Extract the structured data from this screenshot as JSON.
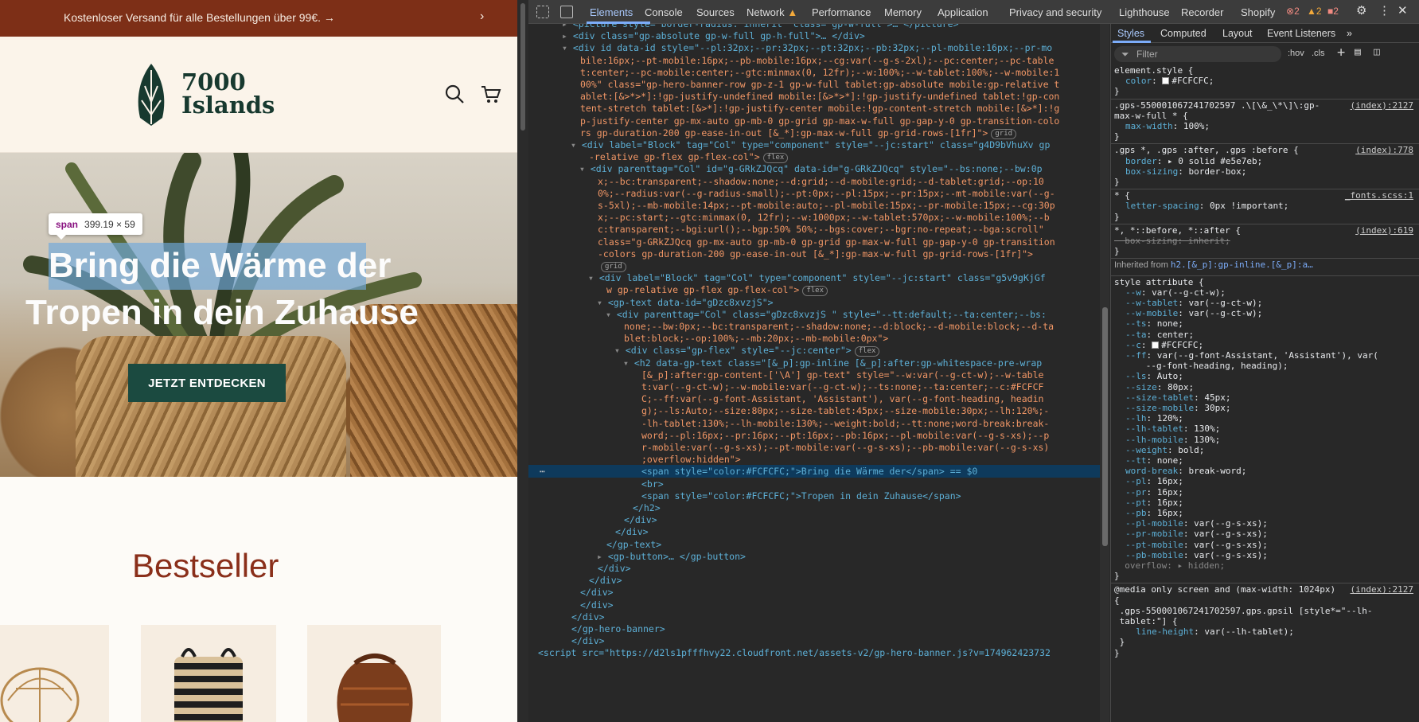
{
  "site": {
    "announcement": "Kostenloser Versand für alle Bestellungen über 99€.",
    "logo_line1": "7000",
    "logo_line2": "Islands",
    "tooltip_tag": "span",
    "tooltip_size": "399.19 × 59",
    "hero_line1": "Bring die Wärme der",
    "hero_line2": "Tropen in dein Zuhause",
    "cta": "JETZT ENTDECKEN",
    "bestseller": "Bestseller"
  },
  "devtools": {
    "tabs": [
      "Elements",
      "Console",
      "Sources",
      "Network",
      "Performance",
      "Memory",
      "Application",
      "Privacy and security",
      "Lighthouse",
      "Recorder",
      "Shopify"
    ],
    "badges": {
      "errors": "2",
      "warnings": "2",
      "issues": "2"
    },
    "style_tabs": [
      "Styles",
      "Computed",
      "Layout",
      "Event Listeners"
    ],
    "filter_placeholder": "Filter",
    "hov": ":hov",
    "cls": ".cls"
  },
  "dom_lines": [
    {
      "t": "<picture style=\"border-radius: inherit\" class=\"gp-w-full\">… </picture>",
      "i": 0,
      "pre": "▸ "
    },
    {
      "t": "<div class=\"gp-absolute gp-w-full gp-h-full\">… </div>",
      "i": 0,
      "pre": "▸ "
    },
    {
      "t": "<div id data-id style=\"--pl:32px;--pr:32px;--pt:32px;--pb:32px;--pl-mobile:16px;--pr-mo",
      "i": 0,
      "pre": "▾ "
    },
    {
      "t": "bile:16px;--pt-mobile:16px;--pb-mobile:16px;--cg:var(--g-s-2xl);--pc:center;--pc-table",
      "i": 1,
      "pre": ""
    },
    {
      "t": "t:center;--pc-mobile:center;--gtc:minmax(0, 12fr);--w:100%;--w-tablet:100%;--w-mobile:1",
      "i": 1,
      "pre": ""
    },
    {
      "t": "00%\" class=\"gp-hero-banner-row gp-z-1 gp-w-full tablet:gp-absolute mobile:gp-relative t",
      "i": 1,
      "pre": ""
    },
    {
      "t": "ablet:[&>*>*]:!gp-justify-undefined mobile:[&>*>*]:!gp-justify-undefined tablet:!gp-con",
      "i": 1,
      "pre": ""
    },
    {
      "t": "tent-stretch tablet:[&>*]:!gp-justify-center mobile:!gp-content-stretch mobile:[&>*]:!g",
      "i": 1,
      "pre": ""
    },
    {
      "t": "p-justify-center gp-mx-auto gp-mb-0 gp-grid gp-max-w-full gp-gap-y-0 gp-transition-colo",
      "i": 1,
      "pre": ""
    },
    {
      "t": "rs gp-duration-200 gp-ease-in-out [&_*]:gp-max-w-full gp-grid-rows-[1fr]\">",
      "i": 1,
      "pre": "",
      "pill": "grid"
    },
    {
      "t": "<div label=\"Block\" tag=\"Col\" type=\"component\" style=\"--jc:start\" class=\"g4D9bVhuXv gp",
      "i": 1,
      "pre": "▾ "
    },
    {
      "t": "-relative gp-flex gp-flex-col\">",
      "i": 2,
      "pre": "",
      "pill": "flex"
    },
    {
      "t": "<div parenttag=\"Col\" id=\"g-GRkZJQcq\" data-id=\"g-GRkZJQcq\" style=\"--bs:none;--bw:0p",
      "i": 2,
      "pre": "▾ "
    },
    {
      "t": "x;--bc:transparent;--shadow:none;--d:grid;--d-mobile:grid;--d-tablet:grid;--op:10",
      "i": 3,
      "pre": ""
    },
    {
      "t": "0%;--radius:var(--g-radius-small);--pt:0px;--pl:15px;--pr:15px;--mt-mobile:var(--g-",
      "i": 3,
      "pre": ""
    },
    {
      "t": "s-5xl);--mb-mobile:14px;--pt-mobile:auto;--pl-mobile:15px;--pr-mobile:15px;--cg:30p",
      "i": 3,
      "pre": ""
    },
    {
      "t": "x;--pc:start;--gtc:minmax(0, 12fr);--w:1000px;--w-tablet:570px;--w-mobile:100%;--b",
      "i": 3,
      "pre": ""
    },
    {
      "t": "c:transparent;--bgi:url();--bgp:50% 50%;--bgs:cover;--bgr:no-repeat;--bga:scroll\"",
      "i": 3,
      "pre": ""
    },
    {
      "t": "class=\"g-GRkZJQcq gp-mx-auto gp-mb-0 gp-grid gp-max-w-full gp-gap-y-0 gp-transition",
      "i": 3,
      "pre": ""
    },
    {
      "t": "-colors gp-duration-200 gp-ease-in-out [&_*]:gp-max-w-full gp-grid-rows-[1fr]\">",
      "i": 3,
      "pre": ""
    },
    {
      "t": "",
      "i": 3,
      "pre": "",
      "pill": "grid"
    },
    {
      "t": "<div label=\"Block\" tag=\"Col\" type=\"component\" style=\"--jc:start\" class=\"g5v9gKjGf",
      "i": 3,
      "pre": "▾ "
    },
    {
      "t": "w gp-relative gp-flex gp-flex-col\">",
      "i": 4,
      "pre": "",
      "pill": "flex"
    },
    {
      "t": "<gp-text data-id=\"gDzc8xvzjS\">",
      "i": 4,
      "pre": "▾ "
    },
    {
      "t": "<div parenttag=\"Col\" class=\"gDzc8xvzjS \" style=\"--tt:default;--ta:center;--bs:",
      "i": 5,
      "pre": "▾ "
    },
    {
      "t": "none;--bw:0px;--bc:transparent;--shadow:none;--d:block;--d-mobile:block;--d-ta",
      "i": 6,
      "pre": ""
    },
    {
      "t": "blet:block;--op:100%;--mb:20px;--mb-mobile:0px\">",
      "i": 6,
      "pre": ""
    },
    {
      "t": "<div class=\"gp-flex\" style=\"--jc:center\">",
      "i": 6,
      "pre": "▾ ",
      "pill": "flex"
    },
    {
      "t": "<h2 data-gp-text class=\"[&_p]:gp-inline [&_p]:after:gp-whitespace-pre-wrap",
      "i": 7,
      "pre": "▾ "
    },
    {
      "t": "[&_p]:after:gp-content-['\\A'] gp-text\" style=\"--w:var(--g-ct-w);--w-table",
      "i": 8,
      "pre": ""
    },
    {
      "t": "t:var(--g-ct-w);--w-mobile:var(--g-ct-w);--ts:none;--ta:center;--c:#FCFCF",
      "i": 8,
      "pre": ""
    },
    {
      "t": "C;--ff:var(--g-font-Assistant, 'Assistant'), var(--g-font-heading, headin",
      "i": 8,
      "pre": ""
    },
    {
      "t": "g);--ls:Auto;--size:80px;--size-tablet:45px;--size-mobile:30px;--lh:120%;-",
      "i": 8,
      "pre": ""
    },
    {
      "t": "-lh-tablet:130%;--lh-mobile:130%;--weight:bold;--tt:none;word-break:break-",
      "i": 8,
      "pre": ""
    },
    {
      "t": "word;--pl:16px;--pr:16px;--pt:16px;--pb:16px;--pl-mobile:var(--g-s-xs);--p",
      "i": 8,
      "pre": ""
    },
    {
      "t": "r-mobile:var(--g-s-xs);--pt-mobile:var(--g-s-xs);--pb-mobile:var(--g-s-xs)",
      "i": 8,
      "pre": ""
    },
    {
      "t": ";overflow:hidden\">",
      "i": 8,
      "pre": ""
    },
    {
      "t": "<span style=\"color:#FCFCFC;\">Bring die Wärme der</span> == $0",
      "i": 8,
      "pre": "",
      "sel": true
    },
    {
      "t": "<br>",
      "i": 8,
      "pre": ""
    },
    {
      "t": "<span style=\"color:#FCFCFC;\">Tropen in dein Zuhause</span>",
      "i": 8,
      "pre": ""
    },
    {
      "t": "</h2>",
      "i": 7,
      "pre": ""
    },
    {
      "t": "</div>",
      "i": 6,
      "pre": ""
    },
    {
      "t": "</div>",
      "i": 5,
      "pre": ""
    },
    {
      "t": "</gp-text>",
      "i": 4,
      "pre": ""
    },
    {
      "t": "<gp-button>… </gp-button>",
      "i": 4,
      "pre": "▸ "
    },
    {
      "t": "</div>",
      "i": 3,
      "pre": ""
    },
    {
      "t": "</div>",
      "i": 2,
      "pre": ""
    },
    {
      "t": "</div>",
      "i": 1,
      "pre": ""
    },
    {
      "t": "</div>",
      "i": 1,
      "pre": ""
    },
    {
      "t": "</div>",
      "i": 0,
      "pre": ""
    },
    {
      "t": "</gp-hero-banner>",
      "i": 0,
      "pre": ""
    },
    {
      "t": "</div>",
      "i": 0,
      "pre": ""
    },
    {
      "t": "<script src=\"https://d2ls1pfffhvy22.cloudfront.net/assets-v2/gp-hero-banner.js?v=174962423732",
      "i": -1,
      "pre": ""
    }
  ],
  "style_lines": [
    {
      "k": "sel",
      "t": "element.style {"
    },
    {
      "k": "decl",
      "p": "color",
      "v": "#FCFCFC;",
      "sw": true
    },
    {
      "k": "close",
      "t": "}"
    },
    {
      "k": "div"
    },
    {
      "k": "sel",
      "t": ".gps-550001067241702597 .\\[\\&_\\*\\]\\:gp-",
      "src": "(index):2127"
    },
    {
      "k": "sel",
      "t": "max-w-full * {"
    },
    {
      "k": "decl",
      "p": "max-width",
      "v": "100%;"
    },
    {
      "k": "close",
      "t": "}"
    },
    {
      "k": "div"
    },
    {
      "k": "sel",
      "t": ".gps *, .gps :after, .gps :before {",
      "src": "(index):778"
    },
    {
      "k": "decl",
      "p": "border",
      "v": "▸ 0 solid #e5e7eb;"
    },
    {
      "k": "decl",
      "p": "box-sizing",
      "v": "border-box;"
    },
    {
      "k": "close",
      "t": "}"
    },
    {
      "k": "div"
    },
    {
      "k": "sel",
      "t": "* {",
      "src": "_fonts.scss:1"
    },
    {
      "k": "decl",
      "p": "letter-spacing",
      "v": "0px !important;"
    },
    {
      "k": "close",
      "t": "}"
    },
    {
      "k": "div"
    },
    {
      "k": "sel",
      "t": "*, *::before, *::after {",
      "src": "(index):619"
    },
    {
      "k": "strike",
      "t": "  box-sizing: inherit;"
    },
    {
      "k": "close",
      "t": "}"
    },
    {
      "k": "div"
    },
    {
      "k": "inh",
      "t": "Inherited from ",
      "u": "h2.[&_p]:gp-inline.[&_p]:a…"
    },
    {
      "k": "div"
    },
    {
      "k": "sel",
      "t": "style attribute {"
    },
    {
      "k": "decl",
      "p": "--w",
      "v": "var(--g-ct-w);"
    },
    {
      "k": "decl",
      "p": "--w-tablet",
      "v": "var(--g-ct-w);"
    },
    {
      "k": "decl",
      "p": "--w-mobile",
      "v": "var(--g-ct-w);"
    },
    {
      "k": "decl",
      "p": "--ts",
      "v": "none;"
    },
    {
      "k": "decl",
      "p": "--ta",
      "v": "center;"
    },
    {
      "k": "decl",
      "p": "--c",
      "v": "#FCFCFC;",
      "sw": true
    },
    {
      "k": "decl",
      "p": "--ff",
      "v": "var(--g-font-Assistant, 'Assistant'), var("
    },
    {
      "k": "cont",
      "t": "      --g-font-heading, heading);"
    },
    {
      "k": "decl",
      "p": "--ls",
      "v": "Auto;"
    },
    {
      "k": "decl",
      "p": "--size",
      "v": "80px;"
    },
    {
      "k": "decl",
      "p": "--size-tablet",
      "v": "45px;"
    },
    {
      "k": "decl",
      "p": "--size-mobile",
      "v": "30px;"
    },
    {
      "k": "decl",
      "p": "--lh",
      "v": "120%;"
    },
    {
      "k": "decl",
      "p": "--lh-tablet",
      "v": "130%;"
    },
    {
      "k": "decl",
      "p": "--lh-mobile",
      "v": "130%;"
    },
    {
      "k": "decl",
      "p": "--weight",
      "v": "bold;"
    },
    {
      "k": "decl",
      "p": "--tt",
      "v": "none;"
    },
    {
      "k": "decl",
      "p": "word-break",
      "v": "break-word;"
    },
    {
      "k": "decl",
      "p": "--pl",
      "v": "16px;"
    },
    {
      "k": "decl",
      "p": "--pr",
      "v": "16px;"
    },
    {
      "k": "decl",
      "p": "--pt",
      "v": "16px;"
    },
    {
      "k": "decl",
      "p": "--pb",
      "v": "16px;"
    },
    {
      "k": "decl",
      "p": "--pl-mobile",
      "v": "var(--g-s-xs);"
    },
    {
      "k": "decl",
      "p": "--pr-mobile",
      "v": "var(--g-s-xs);"
    },
    {
      "k": "decl",
      "p": "--pt-mobile",
      "v": "var(--g-s-xs);"
    },
    {
      "k": "decl",
      "p": "--pb-mobile",
      "v": "var(--g-s-xs);"
    },
    {
      "k": "dim",
      "t": "  overflow: ▸ hidden;"
    },
    {
      "k": "close",
      "t": "}"
    },
    {
      "k": "div"
    },
    {
      "k": "sel",
      "t": "@media only screen and (max-width: 1024px)",
      "src": "(index):2127"
    },
    {
      "k": "close",
      "t": "{"
    },
    {
      "k": "sel",
      "t": " .gps-550001067241702597.gps.gpsil [style*=\"--lh-"
    },
    {
      "k": "sel",
      "t": " tablet:\"] {"
    },
    {
      "k": "decl",
      "p": "  line-height",
      "v": "var(--lh-tablet);"
    },
    {
      "k": "close",
      "t": " }"
    },
    {
      "k": "close",
      "t": "}"
    }
  ]
}
